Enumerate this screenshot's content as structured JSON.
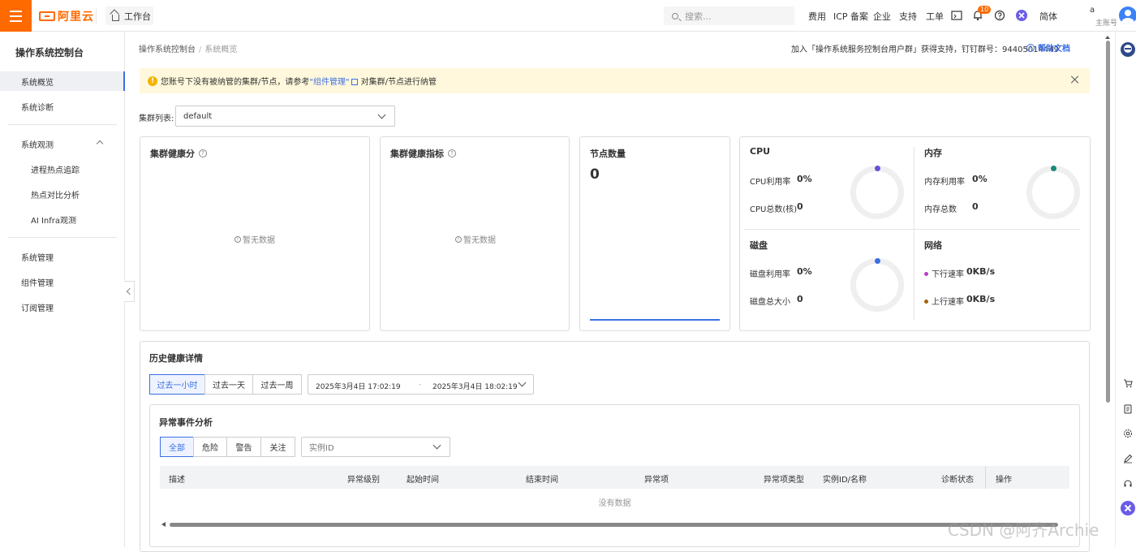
{
  "topbar": {
    "logo_text": "阿里云",
    "workbench": "工作台",
    "search_placeholder": "搜索...",
    "nav": [
      "费用",
      "ICP 备案",
      "企业",
      "支持",
      "工单"
    ],
    "notification_count": "10",
    "language": "简体",
    "account_name": "a",
    "account_role": "主账号"
  },
  "sidebar": {
    "title": "操作系统控制台",
    "items": {
      "overview": "系统概览",
      "diagnosis": "系统诊断",
      "observe": "系统观测",
      "hotspot_trace": "进程热点追踪",
      "hotspot_compare": "热点对比分析",
      "ai_infra": "AI Infra观测",
      "sys_manage": "系统管理",
      "component_manage": "组件管理",
      "subscription_manage": "订阅管理"
    }
  },
  "breadcrumb": {
    "root": "操作系统控制台",
    "current": "系统概览"
  },
  "header": {
    "join_text": "加入「操作系统服务控制台用户群」获得支持，钉钉群号：94405014449",
    "help_doc": "帮助文档"
  },
  "alert": {
    "prefix": "您账号下没有被纳管的集群/节点，请参考",
    "link": "\"组件管理\"",
    "suffix": "对集群/节点进行纳管"
  },
  "cluster": {
    "label": "集群列表:",
    "selected": "default"
  },
  "cards": {
    "health_score": {
      "title": "集群健康分",
      "empty": "暂无数据"
    },
    "health_metrics": {
      "title": "集群健康指标",
      "empty": "暂无数据"
    },
    "node_count": {
      "title": "节点数量",
      "value": "0"
    }
  },
  "resources": {
    "cpu": {
      "title": "CPU",
      "usage_label": "CPU利用率",
      "usage_value": "0%",
      "total_label": "CPU总数(核)",
      "total_value": "0",
      "color": "#6b4fd8"
    },
    "memory": {
      "title": "内存",
      "usage_label": "内存利用率",
      "usage_value": "0%",
      "total_label": "内存总数",
      "total_value": "0",
      "color": "#1a8a7a"
    },
    "disk": {
      "title": "磁盘",
      "usage_label": "磁盘利用率",
      "usage_value": "0%",
      "total_label": "磁盘总大小",
      "total_value": "0",
      "color": "#3c6fe4"
    },
    "network": {
      "title": "网络",
      "down_label": "下行速率",
      "down_value": "0KB/s",
      "up_label": "上行速率",
      "up_value": "0KB/s",
      "down_color": "#b93ec4",
      "up_color": "#a0620c"
    }
  },
  "history": {
    "title": "历史健康详情",
    "ranges": [
      "过去一小时",
      "过去一天",
      "过去一周"
    ],
    "start": "2025年3月4日 17:02:19",
    "separator": "-",
    "end": "2025年3月4日 18:02:19"
  },
  "anomaly": {
    "title": "异常事件分析",
    "filters": [
      "全部",
      "危险",
      "警告",
      "关注"
    ],
    "instance_placeholder": "实例ID",
    "columns": [
      "描述",
      "异常级别",
      "起始时间",
      "结束时间",
      "异常项",
      "异常项类型",
      "实例ID/名称",
      "诊断状态",
      "操作"
    ],
    "empty": "没有数据"
  },
  "watermark": "CSDN @阿齐Archie",
  "accent_color": "#ff6a00",
  "primary_color": "#3c6fe4"
}
